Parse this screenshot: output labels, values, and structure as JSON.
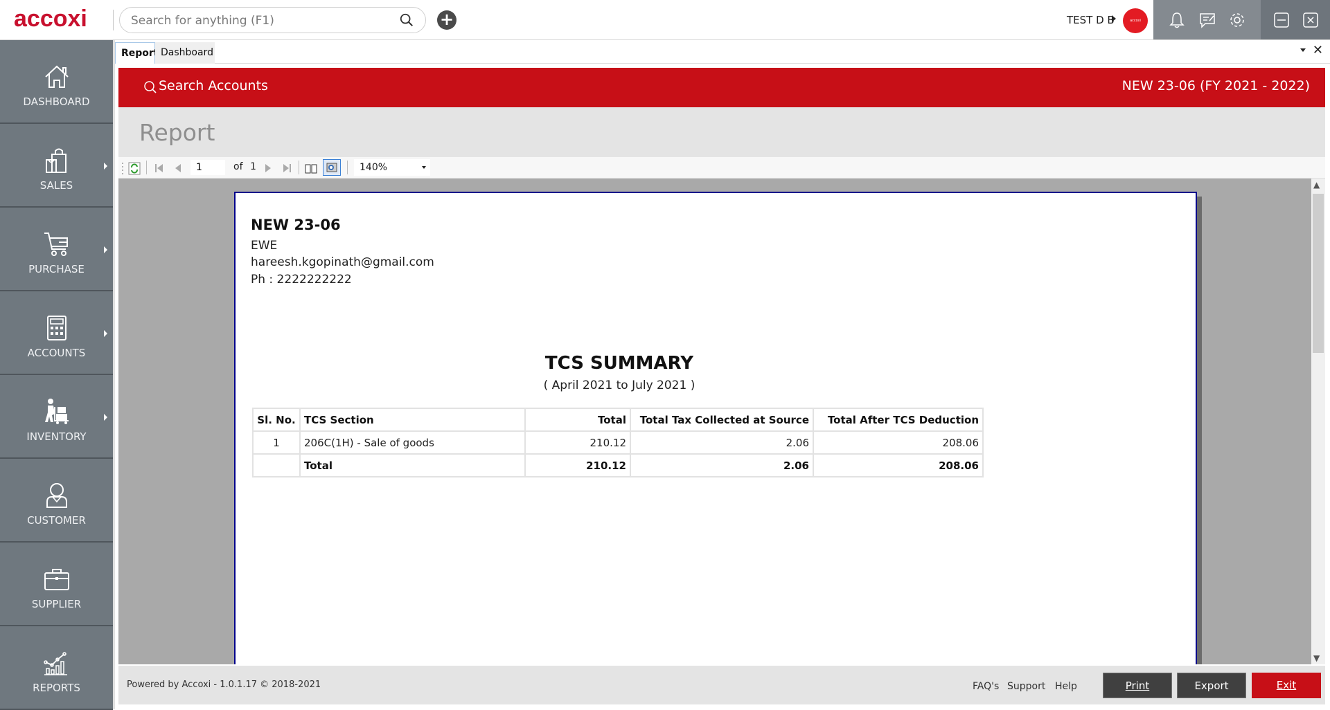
{
  "app": {
    "logo_text": "accoxi",
    "search_placeholder": "Search for anything (F1)",
    "user_name": "TEST D B",
    "avatar_text": "accoxi"
  },
  "sidebar": {
    "items": [
      {
        "label": "DASHBOARD",
        "icon": "home-icon",
        "has_submenu": false
      },
      {
        "label": "SALES",
        "icon": "shopping-bag-icon",
        "has_submenu": true
      },
      {
        "label": "PURCHASE",
        "icon": "cart-icon",
        "has_submenu": true
      },
      {
        "label": "ACCOUNTS",
        "icon": "calculator-icon",
        "has_submenu": true
      },
      {
        "label": "INVENTORY",
        "icon": "worker-trolley-icon",
        "has_submenu": true
      },
      {
        "label": "CUSTOMER",
        "icon": "person-icon",
        "has_submenu": false
      },
      {
        "label": "SUPPLIER",
        "icon": "briefcase-icon",
        "has_submenu": false
      },
      {
        "label": "REPORTS",
        "icon": "chart-icon",
        "has_submenu": false
      }
    ]
  },
  "tabs": [
    {
      "label": "Report",
      "active": true
    },
    {
      "label": "Dashboard",
      "active": false
    }
  ],
  "redbar": {
    "search_label": "Search Accounts",
    "company_fy": "NEW 23-06 (FY 2021 - 2022)"
  },
  "page_title": "Report",
  "toolbar": {
    "current_page": "1",
    "of_label": "of",
    "total_pages": "1",
    "zoom": "140%"
  },
  "report": {
    "company_name": "NEW 23-06",
    "address_line": "EWE",
    "email": "hareesh.kgopinath@gmail.com",
    "phone": "Ph : 2222222222",
    "title": "TCS SUMMARY",
    "range": "( April 2021 to July 2021 )",
    "columns": [
      "Sl. No.",
      "TCS Section",
      "Total",
      "Total Tax Collected at Source",
      "Total After TCS Deduction"
    ],
    "rows": [
      {
        "sl": "1",
        "section": "206C(1H) - Sale of goods",
        "total": "210.12",
        "tcs": "2.06",
        "after": "208.06"
      }
    ],
    "totals": {
      "label": "Total",
      "total": "210.12",
      "tcs": "2.06",
      "after": "208.06"
    }
  },
  "footer": {
    "powered": "Powered by Accoxi - 1.0.1.17 © 2018-2021",
    "links": [
      "FAQ's",
      "Support",
      "Help"
    ],
    "print_label": "Print",
    "export_label": "Export",
    "exit_label": "Exit"
  },
  "colors": {
    "brand_red": "#c70f17",
    "sidebar_bg": "#6f787f",
    "page_border": "#00008b"
  }
}
